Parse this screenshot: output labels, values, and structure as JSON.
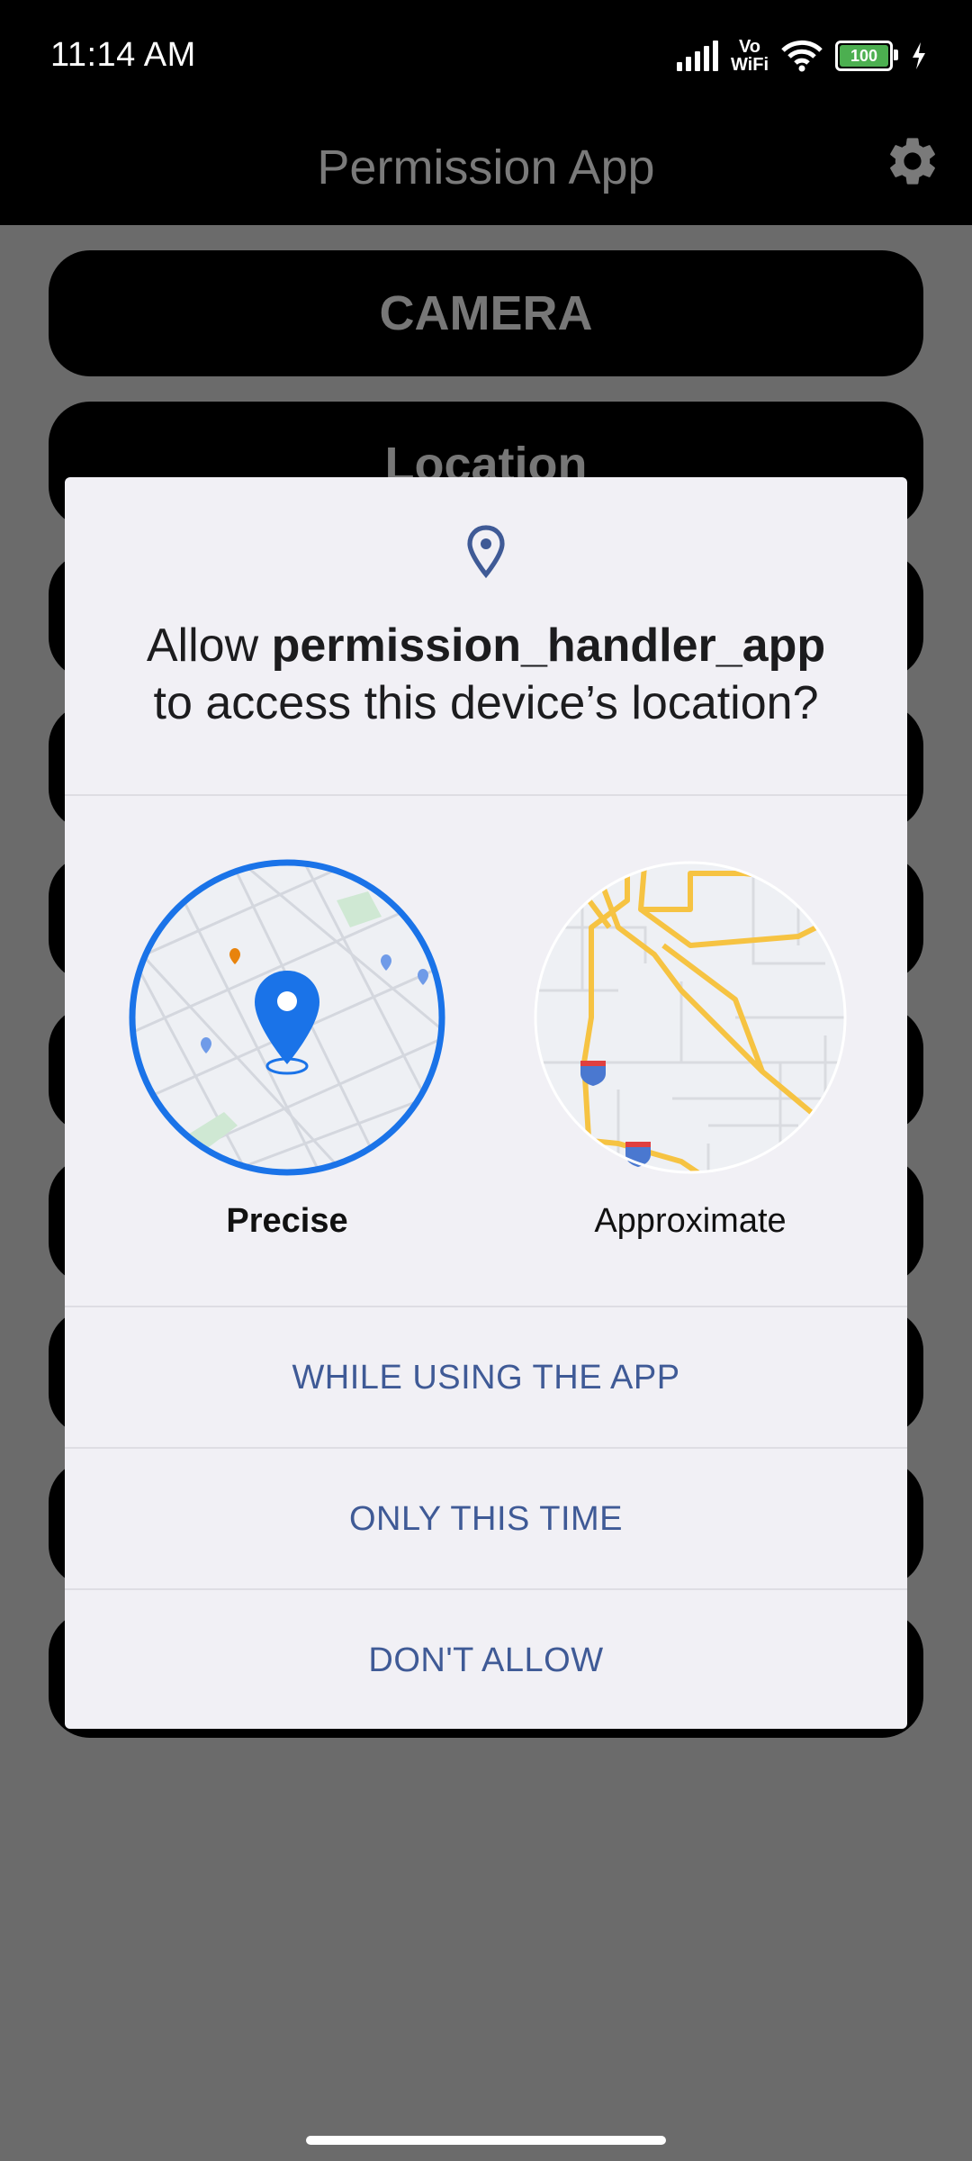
{
  "status_bar": {
    "time": "11:14 AM",
    "vowifi_top": "Vo",
    "vowifi_bottom": "WiFi",
    "battery_level": "100"
  },
  "app_bar": {
    "title": "Permission App",
    "settings_icon": "gear-icon"
  },
  "buttons": [
    {
      "label": "CAMERA"
    },
    {
      "label": "Location"
    },
    {
      "label": ""
    },
    {
      "label": ""
    },
    {
      "label": ""
    },
    {
      "label": ""
    },
    {
      "label": ""
    },
    {
      "label": ""
    },
    {
      "label": ""
    },
    {
      "label": ""
    }
  ],
  "dialog": {
    "icon": "location-pin-icon",
    "title_prefix": "Allow ",
    "app_name": "permission_handler_app",
    "title_suffix": "to access this device’s location?",
    "options": [
      {
        "label": "Precise",
        "selected": true
      },
      {
        "label": "Approximate",
        "selected": false
      }
    ],
    "actions": {
      "while_using": "WHILE USING THE APP",
      "only_this_time": "ONLY THIS TIME",
      "dont_allow": "DON'T ALLOW"
    }
  },
  "colors": {
    "accent": "#1a73e8",
    "action_text": "#3f5a96",
    "scrim": "#6b6b6b"
  }
}
